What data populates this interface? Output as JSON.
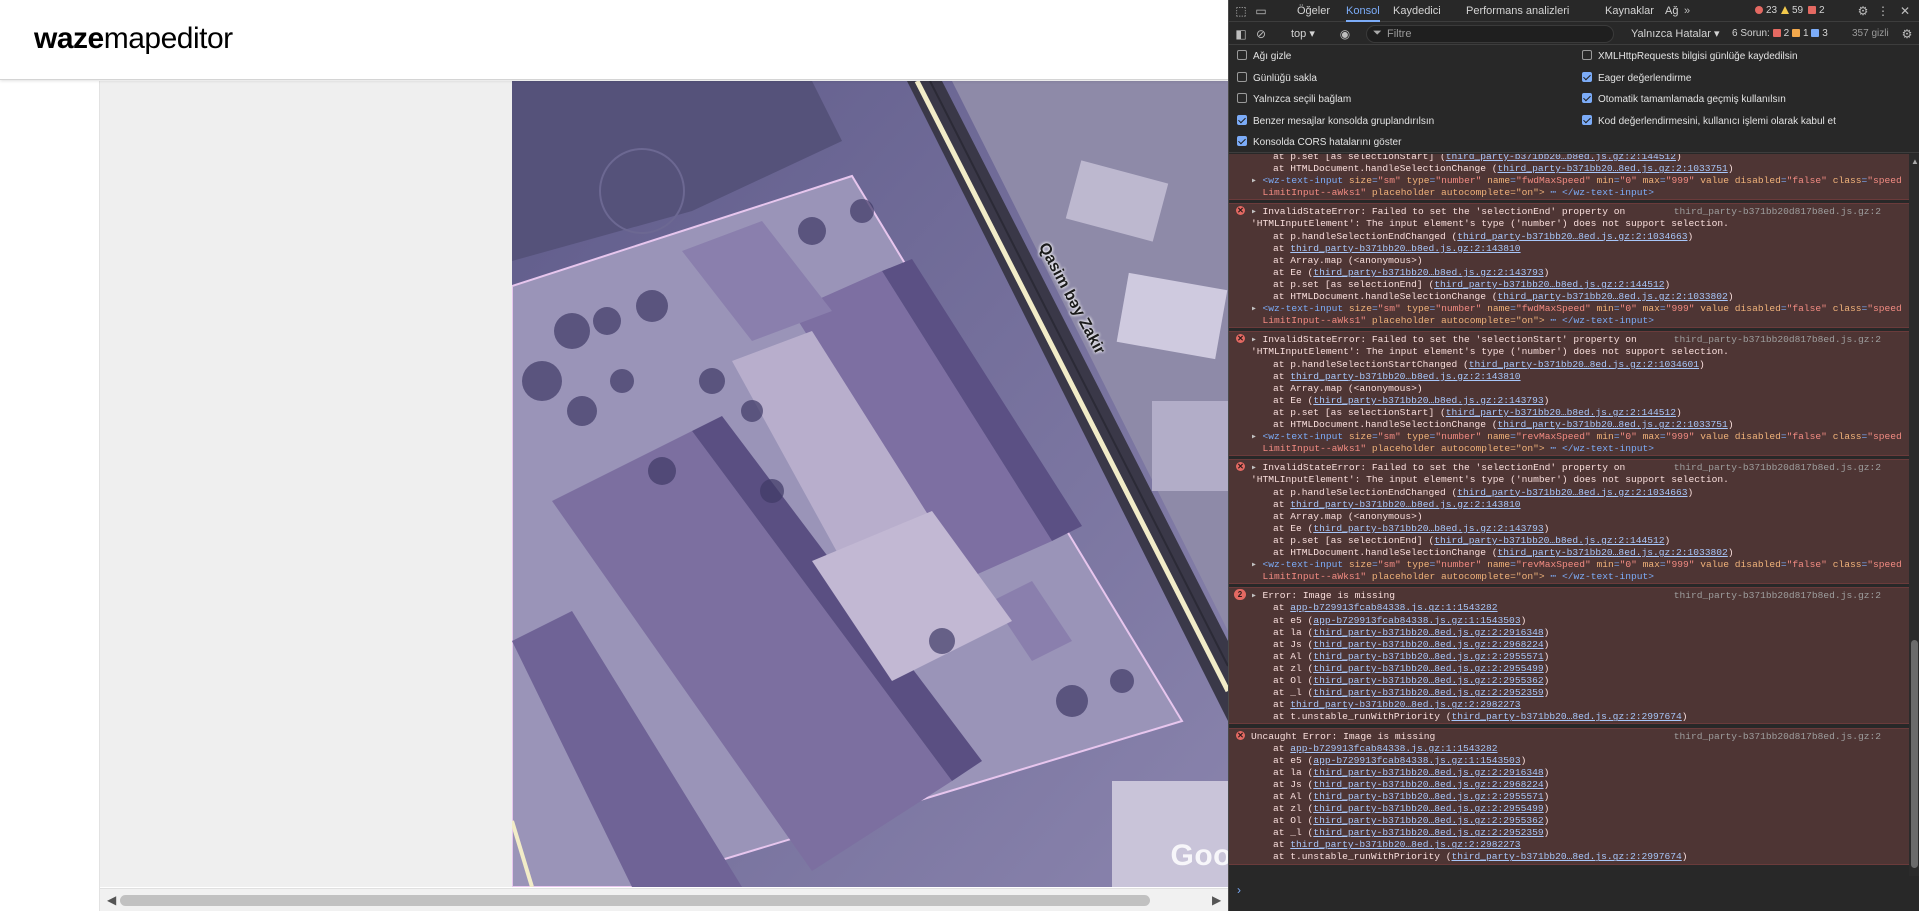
{
  "waze": {
    "logo_bold": "waze",
    "logo_light": "mapeditor",
    "street_name": "Qasim bəy Zakir",
    "map_watermark": "Goo"
  },
  "devtools": {
    "tabs": [
      {
        "label": "Öğeler"
      },
      {
        "label": "Konsol",
        "active": true
      },
      {
        "label": "Kaydedici"
      },
      {
        "label": "Performans analizleri"
      },
      {
        "label": "Kaynaklar"
      },
      {
        "label": "Ağ"
      }
    ],
    "more_tabs": "»",
    "counts": {
      "errors": "23",
      "warnings": "59",
      "issues": "2"
    },
    "toolbar": {
      "context": "top",
      "filter_placeholder": "Filtre",
      "level": "Yalnızca Hatalar",
      "issues_label": "6 Sorun:",
      "issues_red": "2",
      "issues_yellow": "1",
      "issues_blue": "3",
      "hidden": "357 gizli"
    },
    "settings": [
      {
        "label": "Ağı gizle",
        "checked": false
      },
      {
        "label": "XMLHttpRequests bilgisi günlüğe kaydedilsin",
        "checked": false
      },
      {
        "label": "Günlüğü sakla",
        "checked": false
      },
      {
        "label": "Eager değerlendirme",
        "checked": true
      },
      {
        "label": "Yalnızca seçili bağlam",
        "checked": false
      },
      {
        "label": "Otomatik tamamlamada geçmiş kullanılsın",
        "checked": true
      },
      {
        "label": "Benzer mesajlar konsolda gruplandırılsın",
        "checked": true
      },
      {
        "label": "Kod değerlendirmesini, kullanıcı işlemi olarak kabul et",
        "checked": true
      },
      {
        "label": "Konsolda CORS hatalarını göster",
        "checked": true
      }
    ],
    "source_file": "third_party-b371bb20d817b8ed.js.gz:2",
    "msg0_lines": [
      "at p.set [as selectionStart] (|third_party-b371bb20…b8ed.js.gz:2:144512|)",
      "at HTMLDocument.handleSelectionChange (|third_party-b371bb20…8ed.js.gz:2:1033751|)"
    ],
    "msg0_html": {
      "size": "sm",
      "type": "number",
      "name": "fwdMaxSpeed",
      "min": "0",
      "max": "999",
      "value": "false",
      "class": "speed",
      "class2": "LimitInput--aWks1",
      "tail": "placeholder autocomplete=\"on\">",
      "close": "</wz-text-input>"
    },
    "messages": [
      {
        "head1": "InvalidStateError: Failed to set the 'selectionEnd' property on",
        "head2": "'HTMLInputElement': The input element's type ('number') does not support selection.",
        "stack": [
          "at p.handleSelectionEndChanged (|third_party-b371bb20…8ed.js.gz:2:1034663|)",
          "at |third_party-b371bb20…b8ed.js.gz:2:143810|",
          "at Array.map (<anonymous>)",
          "at Ee (|third_party-b371bb20…b8ed.js.gz:2:143793|)",
          "at p.set [as selectionEnd] (|third_party-b371bb20…b8ed.js.gz:2:144512|)",
          "at HTMLDocument.handleSelectionChange (|third_party-b371bb20…8ed.js.gz:2:1033802|)"
        ],
        "html_name": "fwdMaxSpeed"
      },
      {
        "head1": "InvalidStateError: Failed to set the 'selectionStart' property on",
        "head2": "'HTMLInputElement': The input element's type ('number') does not support selection.",
        "stack": [
          "at p.handleSelectionStartChanged (|third_party-b371bb20…8ed.js.gz:2:1034601|)",
          "at |third_party-b371bb20…b8ed.js.gz:2:143810|",
          "at Array.map (<anonymous>)",
          "at Ee (|third_party-b371bb20…b8ed.js.gz:2:143793|)",
          "at p.set [as selectionStart] (|third_party-b371bb20…b8ed.js.gz:2:144512|)",
          "at HTMLDocument.handleSelectionChange (|third_party-b371bb20…8ed.js.gz:2:1033751|)"
        ],
        "html_name": "revMaxSpeed"
      },
      {
        "head1": "InvalidStateError: Failed to set the 'selectionEnd' property on",
        "head2": "'HTMLInputElement': The input element's type ('number') does not support selection.",
        "stack": [
          "at p.handleSelectionEndChanged (|third_party-b371bb20…8ed.js.gz:2:1034663|)",
          "at |third_party-b371bb20…b8ed.js.gz:2:143810|",
          "at Array.map (<anonymous>)",
          "at Ee (|third_party-b371bb20…b8ed.js.gz:2:143793|)",
          "at p.set [as selectionEnd] (|third_party-b371bb20…b8ed.js.gz:2:144512|)",
          "at HTMLDocument.handleSelectionChange (|third_party-b371bb20…8ed.js.gz:2:1033802|)"
        ],
        "html_name": "revMaxSpeed"
      }
    ],
    "image_error": {
      "repeat": "2",
      "head": "Error: Image is missing",
      "stack": [
        "at |app-b729913fcab84338.js.gz:1:1543282|",
        "at e5 (|app-b729913fcab84338.js.gz:1:1543503|)",
        "at la (|third_party-b371bb20…8ed.js.gz:2:2916348|)",
        "at Js (|third_party-b371bb20…8ed.js.gz:2:2968224|)",
        "at Al (|third_party-b371bb20…8ed.js.gz:2:2955571|)",
        "at zl (|third_party-b371bb20…8ed.js.gz:2:2955499|)",
        "at Ol (|third_party-b371bb20…8ed.js.gz:2:2955362|)",
        "at _l (|third_party-b371bb20…8ed.js.gz:2:2952359|)",
        "at |third_party-b371bb20…8ed.js.gz:2:2982273|",
        "at t.unstable_runWithPriority (|third_party-b371bb20…8ed.js.gz:2:2997674|)"
      ]
    },
    "uncaught_error": {
      "head": "Uncaught Error: Image is missing",
      "stack": [
        "at |app-b729913fcab84338.js.gz:1:1543282|",
        "at e5 (|app-b729913fcab84338.js.gz:1:1543503|)",
        "at la (|third_party-b371bb20…8ed.js.gz:2:2916348|)",
        "at Js (|third_party-b371bb20…8ed.js.gz:2:2968224|)",
        "at Al (|third_party-b371bb20…8ed.js.gz:2:2955571|)",
        "at zl (|third_party-b371bb20…8ed.js.gz:2:2955499|)",
        "at Ol (|third_party-b371bb20…8ed.js.gz:2:2955362|)",
        "at _l (|third_party-b371bb20…8ed.js.gz:2:2952359|)",
        "at |third_party-b371bb20…8ed.js.gz:2:2982273|",
        "at t.unstable_runWithPriority (|third_party-b371bb20…8ed.js.gz:2:2997674|)"
      ]
    },
    "prompt_caret": "›"
  }
}
